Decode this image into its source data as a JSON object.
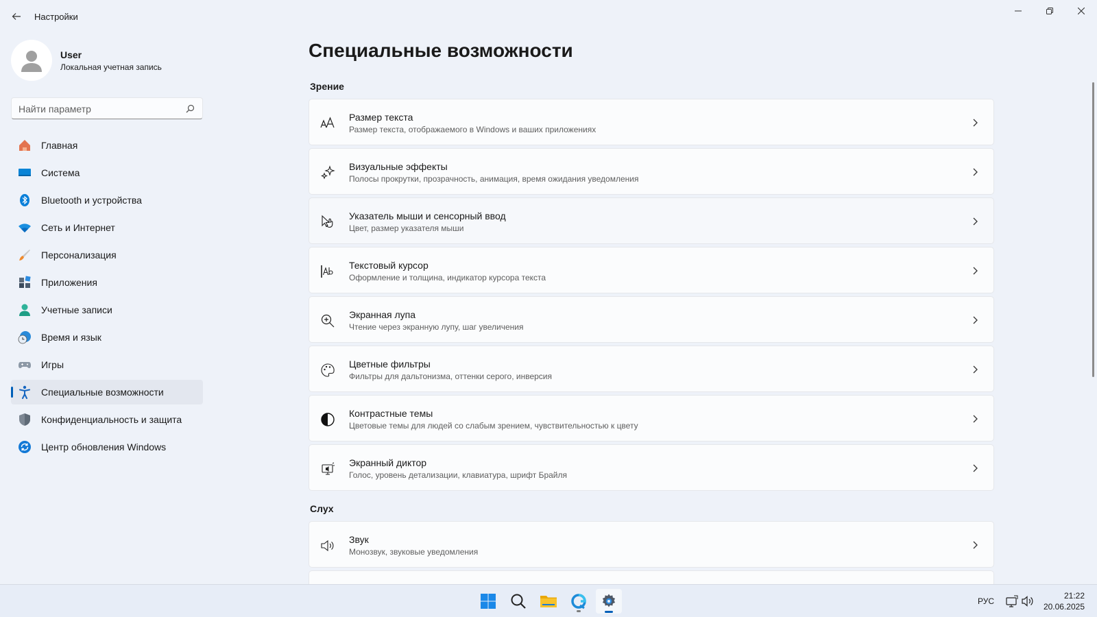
{
  "window": {
    "title": "Настройки"
  },
  "profile": {
    "name": "User",
    "account_type": "Локальная учетная запись"
  },
  "search": {
    "placeholder": "Найти параметр"
  },
  "sidebar": {
    "items": [
      {
        "label": "Главная",
        "icon": "home-icon",
        "active": false
      },
      {
        "label": "Система",
        "icon": "system-icon",
        "active": false
      },
      {
        "label": "Bluetooth и устройства",
        "icon": "bluetooth-icon",
        "active": false
      },
      {
        "label": "Сеть и Интернет",
        "icon": "wifi-icon",
        "active": false
      },
      {
        "label": "Персонализация",
        "icon": "brush-icon",
        "active": false
      },
      {
        "label": "Приложения",
        "icon": "apps-icon",
        "active": false
      },
      {
        "label": "Учетные записи",
        "icon": "accounts-icon",
        "active": false
      },
      {
        "label": "Время и язык",
        "icon": "time-language-icon",
        "active": false
      },
      {
        "label": "Игры",
        "icon": "gamepad-icon",
        "active": false
      },
      {
        "label": "Специальные возможности",
        "icon": "accessibility-icon",
        "active": true
      },
      {
        "label": "Конфиденциальность и защита",
        "icon": "shield-icon",
        "active": false
      },
      {
        "label": "Центр обновления Windows",
        "icon": "update-icon",
        "active": false
      }
    ]
  },
  "main": {
    "title": "Специальные возможности",
    "sections": [
      {
        "title": "Зрение",
        "items": [
          {
            "title": "Размер текста",
            "subtitle": "Размер текста, отображаемого в Windows и ваших приложениях",
            "icon": "text-size-icon"
          },
          {
            "title": "Визуальные эффекты",
            "subtitle": "Полосы прокрутки, прозрачность, анимация, время ожидания уведомления",
            "icon": "sparkle-icon"
          },
          {
            "title": "Указатель мыши и сенсорный ввод",
            "subtitle": "Цвет, размер указателя мыши",
            "icon": "pointer-touch-icon"
          },
          {
            "title": "Текстовый курсор",
            "subtitle": "Оформление и толщина, индикатор курсора текста",
            "icon": "text-cursor-icon"
          },
          {
            "title": "Экранная лупа",
            "subtitle": "Чтение через экранную лупу, шаг увеличения",
            "icon": "magnifier-icon"
          },
          {
            "title": "Цветные фильтры",
            "subtitle": "Фильтры для дальтонизма, оттенки серого, инверсия",
            "icon": "palette-icon"
          },
          {
            "title": "Контрастные темы",
            "subtitle": "Цветовые темы для людей со слабым зрением, чувствительностью к цвету",
            "icon": "contrast-icon"
          },
          {
            "title": "Экранный диктор",
            "subtitle": "Голос, уровень детализации, клавиатура, шрифт Брайля",
            "icon": "narrator-icon"
          }
        ]
      },
      {
        "title": "Слух",
        "items": [
          {
            "title": "Звук",
            "subtitle": "Монозвук, звуковые уведомления",
            "icon": "speaker-icon"
          }
        ]
      }
    ]
  },
  "taskbar": {
    "apps": [
      "start-icon",
      "search-icon",
      "file-explorer-icon",
      "browser-icon",
      "settings-icon"
    ],
    "language": "РУС",
    "time": "21:22",
    "date": "20.06.2025"
  },
  "colors": {
    "accent": "#005fb8",
    "background": "#eef2f9",
    "card": "#fbfcfd"
  }
}
